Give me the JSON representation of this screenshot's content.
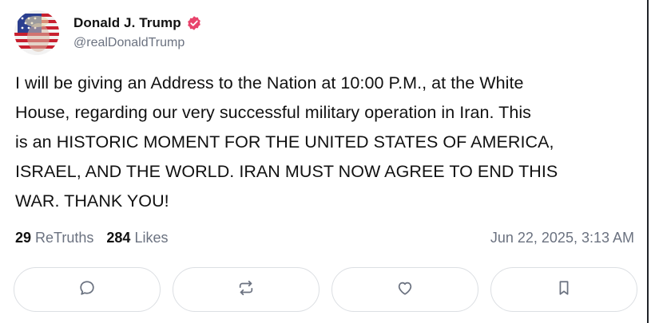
{
  "post": {
    "author": {
      "display_name": "Donald J. Trump",
      "handle": "@realDonaldTrump",
      "verified": true
    },
    "body_lines": [
      "I will be giving an Address to the Nation at 10:00 P.M., at the White",
      "House, regarding our very successful military operation in Iran. This",
      "is an HISTORIC MOMENT FOR THE UNITED STATES OF AMERICA,",
      "ISRAEL, AND THE WORLD. IRAN MUST NOW AGREE TO END THIS",
      "WAR. THANK YOU!"
    ],
    "stats": {
      "retruths_count": "29",
      "retruths_label": "ReTruths",
      "likes_count": "284",
      "likes_label": "Likes"
    },
    "timestamp": "Jun 22, 2025, 3:13 AM"
  },
  "actions": [
    {
      "icon": "reply-icon"
    },
    {
      "icon": "retruth-icon"
    },
    {
      "icon": "like-icon"
    },
    {
      "icon": "bookmark-icon"
    }
  ],
  "colors": {
    "verified_badge": "#e8446c",
    "muted_text": "#6b7280",
    "button_border": "#dcdfe3"
  }
}
